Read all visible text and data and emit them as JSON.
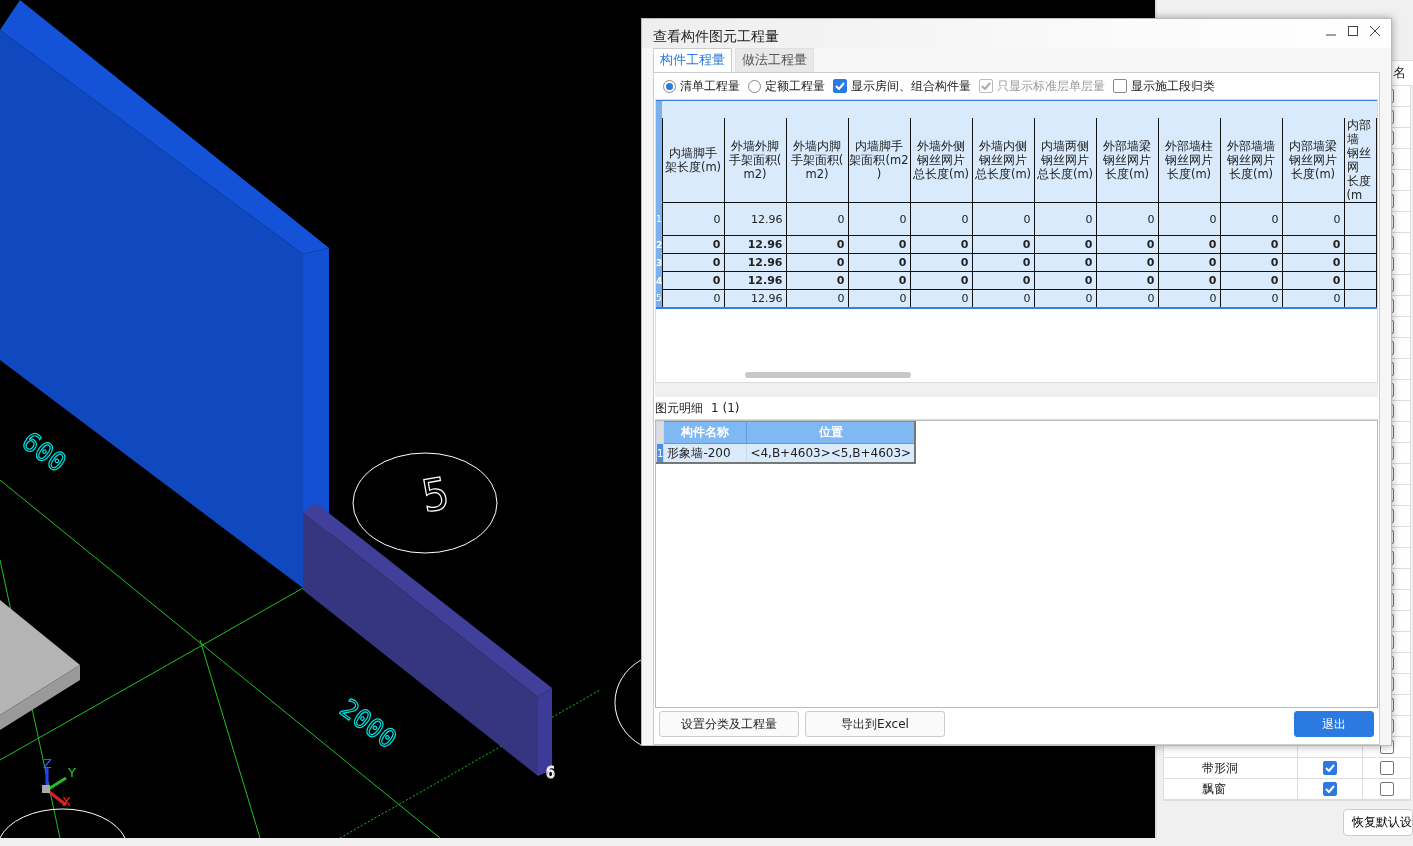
{
  "cad_view": {
    "labels": [
      {
        "kind": "dimension",
        "text": "600"
      },
      {
        "kind": "dimension",
        "text": "2000"
      },
      {
        "kind": "axis",
        "text": "5"
      },
      {
        "kind": "point",
        "text": "6"
      }
    ],
    "triad": [
      "Z",
      "Y",
      "X"
    ]
  },
  "side_panel": {
    "column_header": "名",
    "rows": [
      {
        "checked": false
      },
      {
        "checked": false
      },
      {
        "checked": false
      },
      {
        "checked": false
      },
      {
        "checked": false
      },
      {
        "checked": false
      },
      {
        "checked": false
      },
      {
        "checked": false
      },
      {
        "checked": false
      },
      {
        "checked": false
      },
      {
        "checked": false
      },
      {
        "checked": false
      },
      {
        "checked": false
      },
      {
        "checked": false
      },
      {
        "checked": false
      },
      {
        "checked": false
      },
      {
        "checked": false
      },
      {
        "checked": false
      },
      {
        "checked": false
      },
      {
        "checked": false
      },
      {
        "checked": false
      },
      {
        "checked": false
      },
      {
        "checked": false
      },
      {
        "checked": false
      },
      {
        "checked": false
      },
      {
        "checked": false
      },
      {
        "checked": false
      },
      {
        "checked": false
      },
      {
        "checked": false
      },
      {
        "checked": false
      },
      {
        "checked": false
      },
      {
        "checked": false
      },
      {
        "name": "带形洞",
        "shown": true,
        "checked": false
      },
      {
        "name": "飘窗",
        "shown": true,
        "checked": false
      }
    ],
    "reset_button": "恢复默认设"
  },
  "dialog": {
    "title": "查看构件图元工程量",
    "tabs": [
      {
        "label": "构件工程量",
        "selected": true
      },
      {
        "label": "做法工程量",
        "selected": false
      }
    ],
    "options": [
      {
        "kind": "radio",
        "label": "清单工程量",
        "checked": true,
        "disabled": false
      },
      {
        "kind": "radio",
        "label": "定额工程量",
        "checked": false,
        "disabled": false
      },
      {
        "kind": "checkbox",
        "label": "显示房间、组合构件量",
        "checked": true,
        "disabled": false
      },
      {
        "kind": "checkbox",
        "label": "只显示标准层单层量",
        "checked": true,
        "disabled": true
      },
      {
        "kind": "checkbox",
        "label": "显示施工段归类",
        "checked": false,
        "disabled": false
      }
    ],
    "table": {
      "columns": [
        {
          "lines": [
            "内墙脚手",
            "架长度(m)"
          ]
        },
        {
          "lines": [
            "外墙外脚",
            "手架面积(",
            "m2)"
          ]
        },
        {
          "lines": [
            "外墙内脚",
            "手架面积(",
            "m2)"
          ]
        },
        {
          "lines": [
            "内墙脚手",
            "架面积(m2",
            ")"
          ]
        },
        {
          "lines": [
            "外墙外侧",
            "钢丝网片",
            "总长度(m)"
          ]
        },
        {
          "lines": [
            "外墙内侧",
            "钢丝网片",
            "总长度(m)"
          ]
        },
        {
          "lines": [
            "内墙两侧",
            "钢丝网片",
            "总长度(m)"
          ]
        },
        {
          "lines": [
            "外部墙梁",
            "钢丝网片",
            "长度(m)"
          ]
        },
        {
          "lines": [
            "外部墙柱",
            "钢丝网片",
            "长度(m)"
          ]
        },
        {
          "lines": [
            "外部墙墙",
            "钢丝网片",
            "长度(m)"
          ]
        },
        {
          "lines": [
            "内部墙梁",
            "钢丝网片",
            "长度(m)"
          ]
        },
        {
          "lines": [
            "内部墙",
            "钢丝网",
            "长度(m"
          ]
        }
      ],
      "rows": [
        {
          "number": "1",
          "bold": false,
          "cells": [
            "0",
            "12.96",
            "0",
            "0",
            "0",
            "0",
            "0",
            "0",
            "0",
            "0",
            "0"
          ]
        },
        {
          "number": "2",
          "bold": true,
          "cells": [
            "0",
            "12.96",
            "0",
            "0",
            "0",
            "0",
            "0",
            "0",
            "0",
            "0",
            "0"
          ]
        },
        {
          "number": "3",
          "bold": true,
          "cells": [
            "0",
            "12.96",
            "0",
            "0",
            "0",
            "0",
            "0",
            "0",
            "0",
            "0",
            "0"
          ]
        },
        {
          "number": "4",
          "bold": true,
          "cells": [
            "0",
            "12.96",
            "0",
            "0",
            "0",
            "0",
            "0",
            "0",
            "0",
            "0",
            "0"
          ]
        },
        {
          "number": "5",
          "bold": false,
          "cells": [
            "0",
            "12.96",
            "0",
            "0",
            "0",
            "0",
            "0",
            "0",
            "0",
            "0",
            "0"
          ]
        }
      ]
    },
    "detail": {
      "label": "图元明细",
      "count": "1 (1)",
      "columns": [
        "构件名称",
        "位置"
      ],
      "rows": [
        {
          "number": "1",
          "cells": [
            "形象墙-200",
            "<4,B+4603><5,B+4603>"
          ]
        }
      ]
    },
    "buttons": [
      {
        "kind": "normal",
        "label": "设置分类及工程量"
      },
      {
        "kind": "normal",
        "label": "导出到Excel"
      },
      {
        "kind": "primary",
        "label": "退出"
      }
    ]
  }
}
